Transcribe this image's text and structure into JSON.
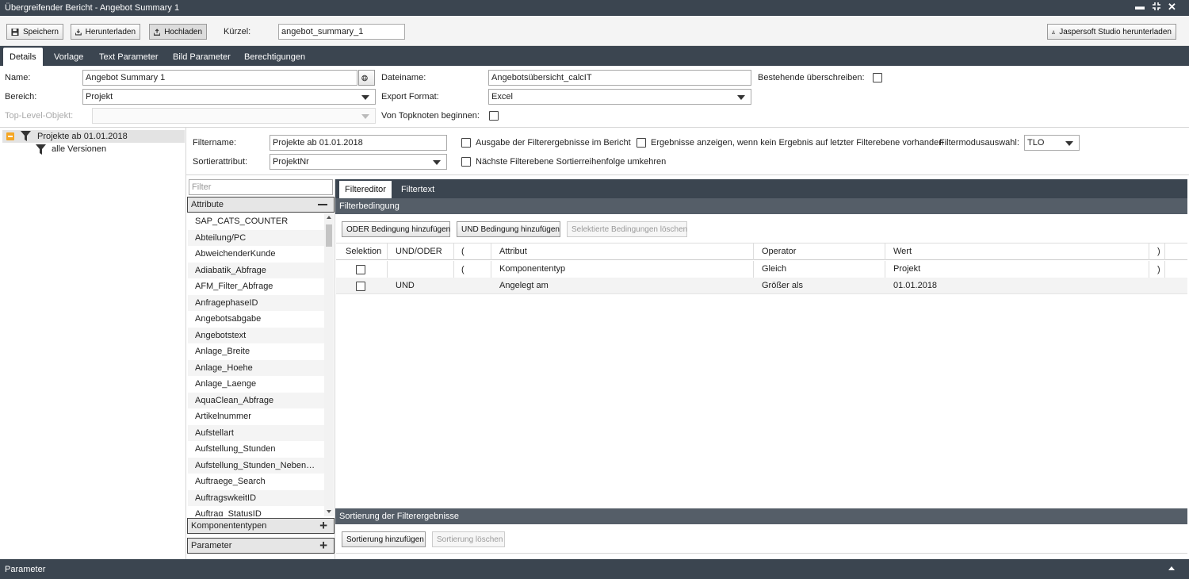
{
  "window": {
    "title": "Übergreifender Bericht - Angebot Summary 1"
  },
  "toolbar": {
    "save": "Speichern",
    "download": "Herunterladen",
    "upload": "Hochladen",
    "short_label": "Kürzel:",
    "short_value": "angebot_summary_1",
    "jasper": "Jaspersoft Studio herunterladen"
  },
  "tabs": [
    "Details",
    "Vorlage",
    "Text Parameter",
    "Bild Parameter",
    "Berechtigungen"
  ],
  "form": {
    "name_label": "Name:",
    "name_value": "Angebot Summary 1",
    "bereich_label": "Bereich:",
    "bereich_value": "Projekt",
    "toplevel_label": "Top-Level-Objekt:",
    "file_label": "Dateiname:",
    "file_value": "Angebotsübersicht_calcIT",
    "export_label": "Export Format:",
    "export_value": "Excel",
    "topknoten_label": "Von Topknoten beginnen:",
    "overwrite_label": "Bestehende überschreiben:"
  },
  "tree": {
    "root": "Projekte ab 01.01.2018",
    "child": "alle Versionen"
  },
  "filter": {
    "name_label": "Filtername:",
    "name_value": "Projekte ab 01.01.2018",
    "sort_label": "Sortierattribut:",
    "sort_value": "ProjektNr",
    "opt1": "Ausgabe der Filterergebnisse im Bericht",
    "opt2": "Nächste Filterebene Sortierreihenfolge umkehren",
    "opt3": "Ergebnisse anzeigen, wenn kein Ergebnis auf letzter Filterebene vorhanden",
    "mode_label": "Filtermodusauswahl:",
    "mode_value": "TLO"
  },
  "attr_panel": {
    "search_placeholder": "Filter",
    "attr_title": "Attribute",
    "items": [
      "SAP_CATS_COUNTER",
      "Abteilung/PC",
      "AbweichenderKunde",
      "Adiabatik_Abfrage",
      "AFM_Filter_Abfrage",
      "AnfragephaseID",
      "Angebotsabgabe",
      "Angebotstext",
      "Anlage_Breite",
      "Anlage_Hoehe",
      "Anlage_Laenge",
      "AquaClean_Abfrage",
      "Artikelnummer",
      "Aufstellart",
      "Aufstellung_Stunden",
      "Aufstellung_Stunden_Nebenkosten",
      "Auftraege_Search",
      "AuftragswkeitID",
      "Auftrag_StatusID"
    ],
    "components": "Komponententypen",
    "parameters": "Parameter"
  },
  "editor": {
    "tabs": [
      "Filtereditor",
      "Filtertext"
    ],
    "section": "Filterbedingung",
    "btn_or": "ODER Bedingung hinzufügen",
    "btn_and": "UND Bedingung hinzufügen",
    "btn_delete": "Selektierte Bedingungen löschen",
    "columns": [
      "Selektion",
      "UND/ODER",
      "(",
      "Attribut",
      "Operator",
      "Wert",
      ")"
    ],
    "rows": [
      {
        "logic": "",
        "open": "(",
        "attribute": "Komponententyp",
        "operator": "Gleich",
        "value": "Projekt",
        "close": ")"
      },
      {
        "logic": "UND",
        "open": "",
        "attribute": "Angelegt am",
        "operator": "Größer als",
        "value": "01.01.2018",
        "close": ""
      }
    ],
    "sort_section": "Sortierung der Filterergebnisse",
    "btn_sort_add": "Sortierung hinzufügen",
    "btn_sort_delete": "Sortierung löschen"
  },
  "bottom": {
    "title": "Parameter"
  }
}
